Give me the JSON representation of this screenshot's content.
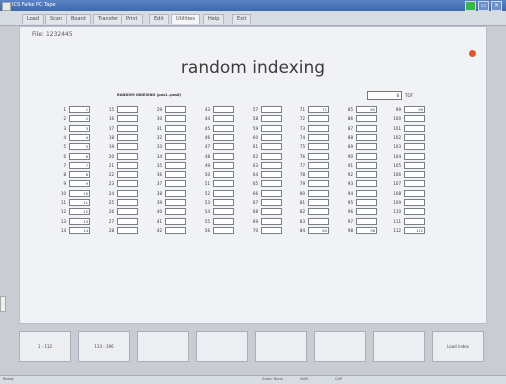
{
  "window": {
    "title": "ICS Falke PC Tape"
  },
  "menu_tabs": [
    "Load",
    "Scan",
    "Board",
    "Transfer",
    "Print",
    "Edit",
    "Utilities",
    "Help",
    "Exit"
  ],
  "active_tab": 6,
  "file_label": "File: 1232445",
  "page_title": "random indexing",
  "grid_caption": "RANDOM INDEXING (pos1..pos8)",
  "total": {
    "value": "8",
    "unit": "TOT"
  },
  "columns": [
    {
      "index_start": 1,
      "values": [
        "1",
        "2",
        "3",
        "4",
        "5",
        "6",
        "7",
        "8",
        "9",
        "10",
        "11",
        "12",
        "13",
        "14"
      ]
    },
    {
      "index_start": 15,
      "values": [
        "",
        "",
        "",
        "",
        "",
        "",
        "",
        "",
        "",
        "",
        "",
        "",
        "",
        ""
      ]
    },
    {
      "index_start": 29,
      "values": [
        "",
        "",
        "",
        "",
        "",
        "",
        "",
        "",
        "",
        "",
        "",
        "",
        "",
        ""
      ]
    },
    {
      "index_start": 43,
      "values": [
        "",
        "",
        "",
        "",
        "",
        "",
        "",
        "",
        "",
        "",
        "",
        "",
        "",
        ""
      ]
    },
    {
      "index_start": 57,
      "values": [
        "",
        "",
        "",
        "",
        "",
        "",
        "",
        "",
        "",
        "",
        "",
        "",
        "",
        ""
      ]
    },
    {
      "index_start": 71,
      "values": [
        "71",
        "",
        "",
        "",
        "",
        "",
        "",
        "",
        "",
        "",
        "",
        "",
        "",
        "84"
      ]
    },
    {
      "index_start": 85,
      "values": [
        "85",
        "",
        "",
        "",
        "",
        "",
        "",
        "",
        "",
        "",
        "",
        "",
        "",
        "98"
      ]
    },
    {
      "index_start": 99,
      "values": [
        "99",
        "",
        "",
        "",
        "",
        "",
        "",
        "",
        "",
        "",
        "",
        "",
        "",
        "112"
      ]
    }
  ],
  "function_buttons": [
    "1 - 112",
    "113 - 196",
    "",
    "",
    "",
    "",
    "",
    "Load index"
  ],
  "status_bar": {
    "left": "Ready",
    "mid1": "Scale: None",
    "mid2": "NUM",
    "mid3": "CAP"
  }
}
